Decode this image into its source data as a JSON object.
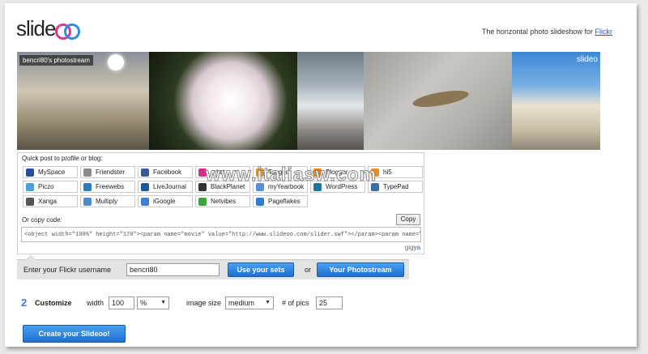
{
  "header": {
    "logo_text": "slide",
    "tagline": "The horizontal photo slideshow for",
    "tagline_link": "Flickr"
  },
  "slideshow": {
    "caption": "bencri80's photostream",
    "logo": "slideo"
  },
  "share": {
    "title": "Quick post to profile or blog:",
    "services": [
      {
        "label": "MySpace",
        "color": "#2a4f9c"
      },
      {
        "label": "Friendster",
        "color": "#8a8a8a"
      },
      {
        "label": "Facebook",
        "color": "#3b5998"
      },
      {
        "label": "orkut",
        "color": "#d02f8c"
      },
      {
        "label": "Tagged",
        "color": "#e09020"
      },
      {
        "label": "Blogger",
        "color": "#f57d00"
      },
      {
        "label": "hi5",
        "color": "#f08a1c"
      },
      {
        "label": "Piczo",
        "color": "#4da0d8"
      },
      {
        "label": "Freewebs",
        "color": "#2a7abf"
      },
      {
        "label": "LiveJournal",
        "color": "#1e5799"
      },
      {
        "label": "BlackPlanet",
        "color": "#333333"
      },
      {
        "label": "myYearbook",
        "color": "#5a8fd6"
      },
      {
        "label": "WordPress",
        "color": "#21759b"
      },
      {
        "label": "TypePad",
        "color": "#3a6ea5"
      },
      {
        "label": "Xanga",
        "color": "#555555"
      },
      {
        "label": "Multiply",
        "color": "#4a8bd0"
      },
      {
        "label": "iGoogle",
        "color": "#3f7fd6"
      },
      {
        "label": "Netvibes",
        "color": "#3aa63a"
      },
      {
        "label": "Pageflakes",
        "color": "#2d7dd2"
      }
    ],
    "copy_label": "Or copy code:",
    "copy_button": "Copy",
    "code": "<object width=\"100%\" height=\"170\"><param name=\"movie\" value=\"http://www.slideoo.com/slider.swf\"></param><param name=\"wmode\"",
    "gigya_prefix": "gig",
    "gigya_suffix": "ya"
  },
  "watermark": "www.italiasw.com",
  "user_bar": {
    "label": "Enter your Flickr username",
    "username": "bencri80",
    "use_sets": "Use your sets",
    "or": "or",
    "photostream": "Your Photostream"
  },
  "customize": {
    "step": "2",
    "title": "Customize",
    "width_label": "width",
    "width_value": "100",
    "unit_value": "%",
    "size_label": "image size",
    "size_value": "medium",
    "pics_label": "# of pics",
    "pics_value": "25"
  },
  "create_button": "Create your Slideoo!"
}
